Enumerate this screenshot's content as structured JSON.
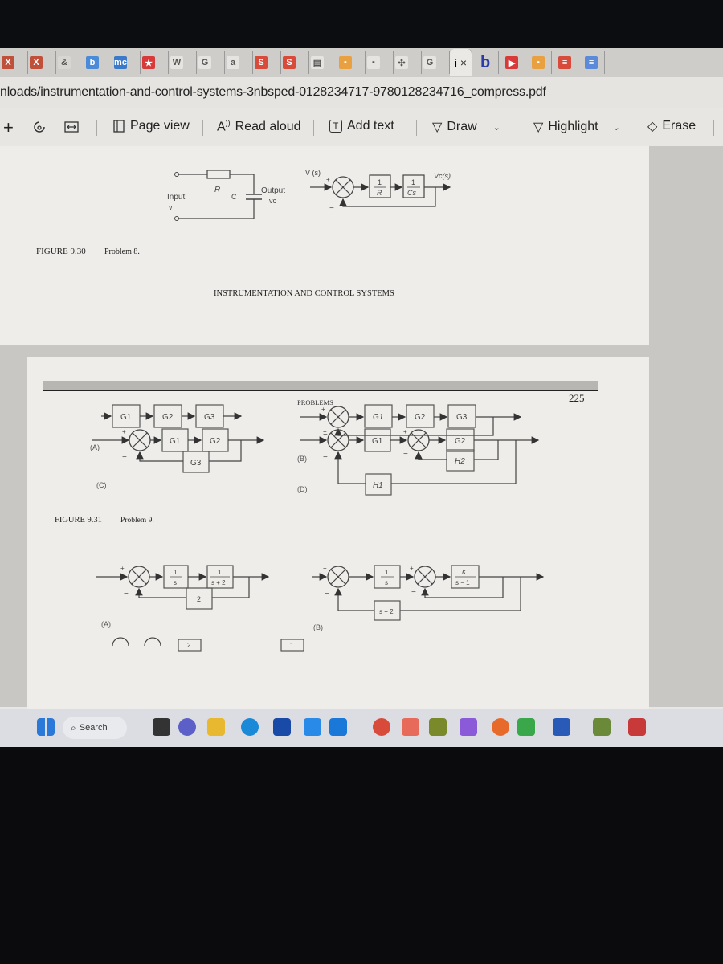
{
  "browser": {
    "tabs": [
      {
        "icon": "x-icon",
        "color": "#c0503a",
        "label": "X"
      },
      {
        "icon": "x-icon",
        "color": "#c0503a",
        "label": "X"
      },
      {
        "icon": "link-icon",
        "color": "#d8d6d3",
        "label": "&"
      },
      {
        "icon": "bing-icon",
        "color": "#4a8ad8",
        "label": "b"
      },
      {
        "icon": "mc-icon",
        "color": "#3a7ac8",
        "label": "mc"
      },
      {
        "icon": "star-icon",
        "color": "#d83a3a",
        "label": "★"
      },
      {
        "icon": "wikipedia-icon",
        "color": "#e6e4e0",
        "label": "W"
      },
      {
        "icon": "google-icon",
        "color": "#e6e4e0",
        "label": "G"
      },
      {
        "icon": "search-tab-icon",
        "color": "#e6e4e0",
        "label": "a"
      },
      {
        "icon": "s-icon",
        "color": "#d84a3a",
        "label": "S"
      },
      {
        "icon": "s-icon",
        "color": "#d84a3a",
        "label": "S"
      },
      {
        "icon": "calendar-icon",
        "color": "#e6e4e0",
        "label": "▤"
      },
      {
        "icon": "orange-tab-icon",
        "color": "#e8a040",
        "label": "▪"
      },
      {
        "icon": "pdf-tab-icon",
        "color": "#e6e4e0",
        "label": "▪"
      },
      {
        "icon": "puzzle-icon",
        "color": "#e6e4e0",
        "label": "✣"
      },
      {
        "icon": "google-icon",
        "color": "#e6e4e0",
        "label": "G"
      }
    ],
    "active_tab": {
      "label": "i",
      "close": "×"
    },
    "extra_tabs": [
      {
        "icon": "bing-b-icon",
        "color": "#2a3aa8",
        "label": "b"
      },
      {
        "icon": "youtube-icon",
        "color": "#d83a3a",
        "label": "▶"
      },
      {
        "icon": "orange-tab-icon",
        "color": "#e8a040",
        "label": "▪"
      },
      {
        "icon": "red-tab-icon",
        "color": "#d84a3a",
        "label": "≡"
      },
      {
        "icon": "docs-icon",
        "color": "#5a8ad8",
        "label": "≡"
      }
    ],
    "address": "nloads/instrumentation-and-control-systems-3nbsped-0128234717-9780128234716_compress.pdf"
  },
  "toolbar": {
    "zoom_in": "+",
    "page_view": "Page view",
    "read_aloud": "Read aloud",
    "add_text": "Add text",
    "draw": "Draw",
    "highlight": "Highlight",
    "erase": "Erase"
  },
  "page1": {
    "circuit": {
      "input": "Input",
      "input_var": "v",
      "resistor": "R",
      "capacitor": "C",
      "output": "Output",
      "output_var": "vc"
    },
    "block": {
      "in_label": "V (s)",
      "plus": "+",
      "minus": "−",
      "block1_num": "1",
      "block1_den": "R",
      "block2_num": "1",
      "block2_den": "Cs",
      "out_label": "Vc(s)"
    },
    "caption_fig": "FIGURE 9.30",
    "caption_text": "Problem 8.",
    "running_header": "INSTRUMENTATION AND CONTROL SYSTEMS"
  },
  "page2": {
    "header": "PROBLEMS",
    "page_number": "225",
    "fig931": {
      "A": {
        "label": "(A)",
        "blocks": [
          "G1",
          "G2",
          "G3"
        ]
      },
      "B": {
        "label": "(B)",
        "blocks": [
          "G1",
          "G2",
          "G3"
        ],
        "plus": "+",
        "minus": "−"
      },
      "C": {
        "label": "(C)",
        "blocks": [
          "G1",
          "G2"
        ],
        "feedback": "G3",
        "plus": "+",
        "minus": "−"
      },
      "D": {
        "label": "(D)",
        "blocks": [
          "G1",
          "G2"
        ],
        "inner_feedback": "H2",
        "outer_feedback": "H1",
        "plus": "+",
        "minus": "−"
      }
    },
    "caption_fig": "FIGURE 9.31",
    "caption_text": "Problem 9.",
    "fig932": {
      "A": {
        "label": "(A)",
        "b1_num": "1",
        "b1_den": "s",
        "b2_num": "1",
        "b2_den": "s + 2",
        "feedback": "2",
        "plus": "+",
        "minus": "−"
      },
      "B": {
        "label": "(B)",
        "b1_num": "1",
        "b1_den": "s",
        "b2_num": "K",
        "b2_den": "s − 1",
        "feedback": "s + 2",
        "plus": "+",
        "minus": "−"
      }
    },
    "partial_next": {
      "block1": "2",
      "block2": "1"
    }
  },
  "taskbar": {
    "search_label": "Search",
    "apps": [
      {
        "name": "start-icon",
        "color": "#2a78d8"
      },
      {
        "name": "task-view-icon",
        "color": "#333333"
      },
      {
        "name": "teams-chat-icon",
        "color": "#5b5fc7"
      },
      {
        "name": "file-explorer-icon",
        "color": "#e8b830"
      },
      {
        "name": "edge-icon",
        "color": "#1a8ad8"
      },
      {
        "name": "store-icon",
        "color": "#1a4aa8"
      },
      {
        "name": "vscode-like-icon",
        "color": "#2a8ae8"
      },
      {
        "name": "mail-icon",
        "color": "#1a78d8"
      },
      {
        "name": "chrome-icon",
        "color": "#d84a3a"
      },
      {
        "name": "snipping-tool-icon",
        "color": "#e86a5a"
      },
      {
        "name": "python-editor-icon",
        "color": "#7a8a2a"
      },
      {
        "name": "visual-studio-icon",
        "color": "#8a5ad8"
      },
      {
        "name": "firefox-icon",
        "color": "#e86a2a"
      },
      {
        "name": "dataspell-icon",
        "color": "#3aa84a"
      },
      {
        "name": "word-icon",
        "color": "#2a5ab8"
      },
      {
        "name": "explorer-tool-icon",
        "color": "#6a8a3a"
      },
      {
        "name": "mcafee-icon",
        "color": "#c83a3a"
      }
    ]
  }
}
